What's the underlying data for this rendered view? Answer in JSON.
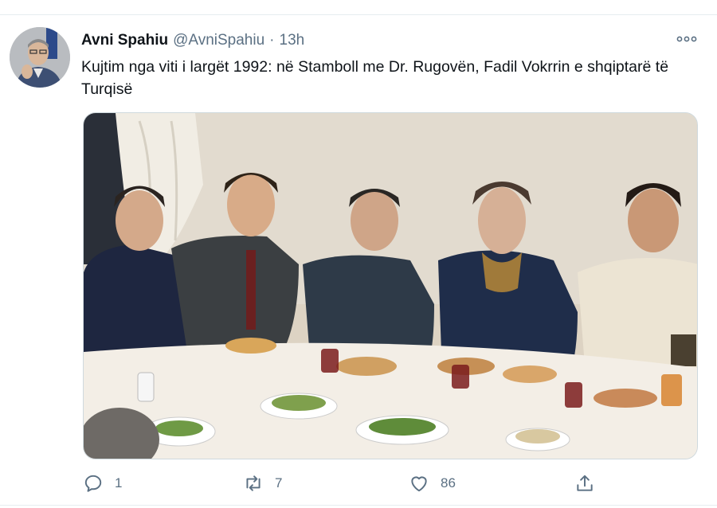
{
  "tweet": {
    "display_name": "Avni Spahiu",
    "handle": "@AvniSpahiu",
    "separator": "·",
    "time": "13h",
    "text": "Kujtim nga viti i largët 1992: në Stamboll me Dr. Rugovën, Fadil Vokrrin e shqiptarë të Turqisë",
    "image_alt": "Group photo at a dinner table, 1992"
  },
  "actions": {
    "reply": {
      "icon": "reply-icon",
      "count": "1"
    },
    "retweet": {
      "icon": "retweet-icon",
      "count": "7"
    },
    "like": {
      "icon": "heart-icon",
      "count": "86"
    },
    "share": {
      "icon": "share-icon"
    }
  },
  "colors": {
    "text_primary": "#0f1419",
    "text_secondary": "#5b7083",
    "divider": "#e6ecf0"
  }
}
